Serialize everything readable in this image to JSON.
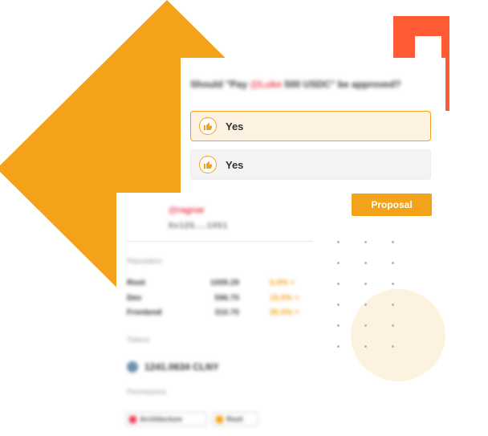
{
  "proposal": {
    "question_prefix": "Should \"Pay ",
    "question_accent": "@Luke",
    "question_suffix": " 500 USDC\" be approved?",
    "options": [
      {
        "label": "Yes",
        "selected": true
      },
      {
        "label": "Yes",
        "selected": false
      }
    ],
    "button_label": "Proposal"
  },
  "author": {
    "name": "@ragnar",
    "address": "0x125....1051"
  },
  "reputation": {
    "label": "Reputation",
    "rows": [
      {
        "name": "Root",
        "value": "1009.29",
        "change": "5.0% +"
      },
      {
        "name": "Dev",
        "value": "596.70",
        "change": "15.0% +"
      },
      {
        "name": "Frontend",
        "value": "310.70",
        "change": "35.0% +"
      }
    ]
  },
  "tokens": {
    "label": "Tokens",
    "amount": "1241.0634 CLNY"
  },
  "permissions": {
    "label": "Permissions",
    "items": [
      {
        "label": "Architecture",
        "color": "#ef3d55"
      },
      {
        "label": "Root",
        "color": "#f5a21b"
      }
    ]
  },
  "colors": {
    "accent_orange": "#f5a21b",
    "accent_red_orange": "#ff5c35",
    "accent_pink": "#ef3d55"
  },
  "icons": {
    "option_icon": "thumbs-up-icon"
  }
}
